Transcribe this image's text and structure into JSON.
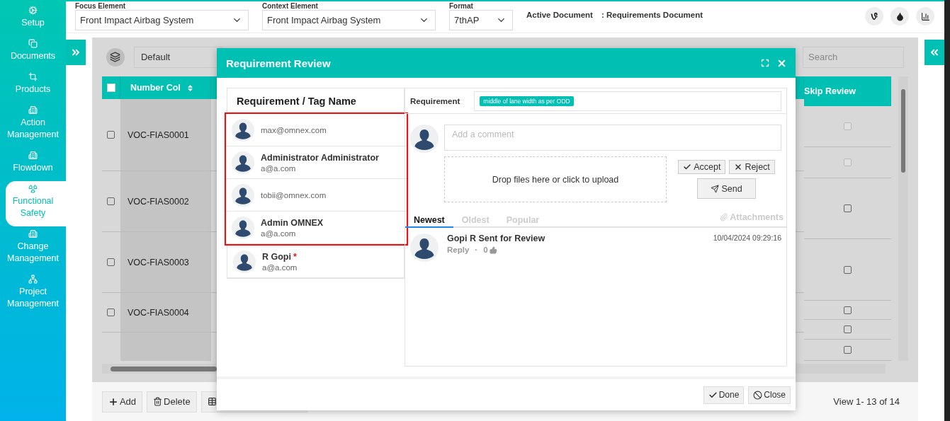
{
  "sidebar": {
    "items": [
      {
        "label": "Setup",
        "selected": false
      },
      {
        "label": "Documents",
        "selected": false
      },
      {
        "label": "Products",
        "selected": false
      },
      {
        "label": "Action Management",
        "selected": false
      },
      {
        "label": "Flowdown",
        "selected": false
      },
      {
        "label": "Functional Safety",
        "selected": true
      },
      {
        "label": "Change Management",
        "selected": false
      },
      {
        "label": "Project Management",
        "selected": false
      }
    ]
  },
  "top_bar": {
    "fields": [
      {
        "label": "Focus Element",
        "value": "Front Impact Airbag System",
        "kind": "wide"
      },
      {
        "label": "Context Element",
        "value": "Front Impact Airbag System",
        "kind": "wide"
      },
      {
        "label": "Format",
        "value": "7thAP",
        "kind": "narrow"
      }
    ],
    "active_document": {
      "label": "Active Document",
      "value": ": Requirements Document"
    }
  },
  "toolbar": {
    "view": "Default",
    "search": {
      "placeholder": "Search"
    }
  },
  "table": {
    "all_selected": false,
    "columns": [
      {
        "label": "Number Col"
      },
      {
        "label": "Skip Review"
      }
    ],
    "rows": [
      {
        "number": "VOC-FIAS0001",
        "checked": false
      },
      {
        "number": "VOC-FIAS0002",
        "checked": false
      },
      {
        "number": "VOC-FIAS0003",
        "checked": false
      },
      {
        "number": "VOC-FIAS0004",
        "checked": false
      }
    ],
    "skip_review": [
      {
        "checked": false,
        "disabled": true
      },
      {
        "checked": false,
        "disabled": true
      },
      {
        "checked": false,
        "disabled": false
      },
      {
        "checked": false,
        "disabled": false
      },
      {
        "checked": false,
        "disabled": false
      },
      {
        "checked": false,
        "disabled": false
      },
      {
        "checked": false,
        "disabled": false
      }
    ]
  },
  "footer": {
    "buttons": [
      {
        "label": "Add",
        "kind": "add"
      },
      {
        "label": "Delete",
        "kind": "delete"
      }
    ],
    "pager": "View 1- 13 of 14"
  },
  "modal": {
    "title": "Requirement Review",
    "list_header": "Requirement / Tag Name",
    "users": [
      {
        "email": "max@omnex.com",
        "highlighted": true
      },
      {
        "name": "Administrator Administrator",
        "email": "a@a.com",
        "highlighted": true
      },
      {
        "email": "tobii@omnex.com",
        "highlighted": true
      },
      {
        "name": "Admin OMNEX",
        "email": "a@a.com",
        "highlighted": true
      },
      {
        "name": "R Gopi",
        "marker": "*",
        "email": "a@a.com",
        "highlighted": false
      }
    ],
    "requirement": {
      "label": "Requirement",
      "tag": "middle of lane width as per ODD"
    },
    "comment": {
      "placeholder": "Add a comment"
    },
    "upload": "Drop files here or click to upload",
    "actions": [
      {
        "label": "Accept",
        "kind": "accept"
      },
      {
        "label": "Reject",
        "kind": "reject"
      },
      {
        "label": "Send",
        "kind": "send"
      }
    ],
    "tabs": [
      {
        "label": "Newest",
        "selected": true
      },
      {
        "label": "Oldest",
        "selected": false
      },
      {
        "label": "Popular",
        "selected": false
      }
    ],
    "attachments": "Attachments",
    "comments": [
      {
        "text": "Gopi R Sent for Review",
        "time": "10/04/2024 09:29:16",
        "reply": "Reply",
        "separator": "·",
        "likes": "0"
      }
    ],
    "buttons": [
      {
        "label": "Done",
        "kind": "done"
      },
      {
        "label": "Close",
        "kind": "close"
      }
    ]
  }
}
